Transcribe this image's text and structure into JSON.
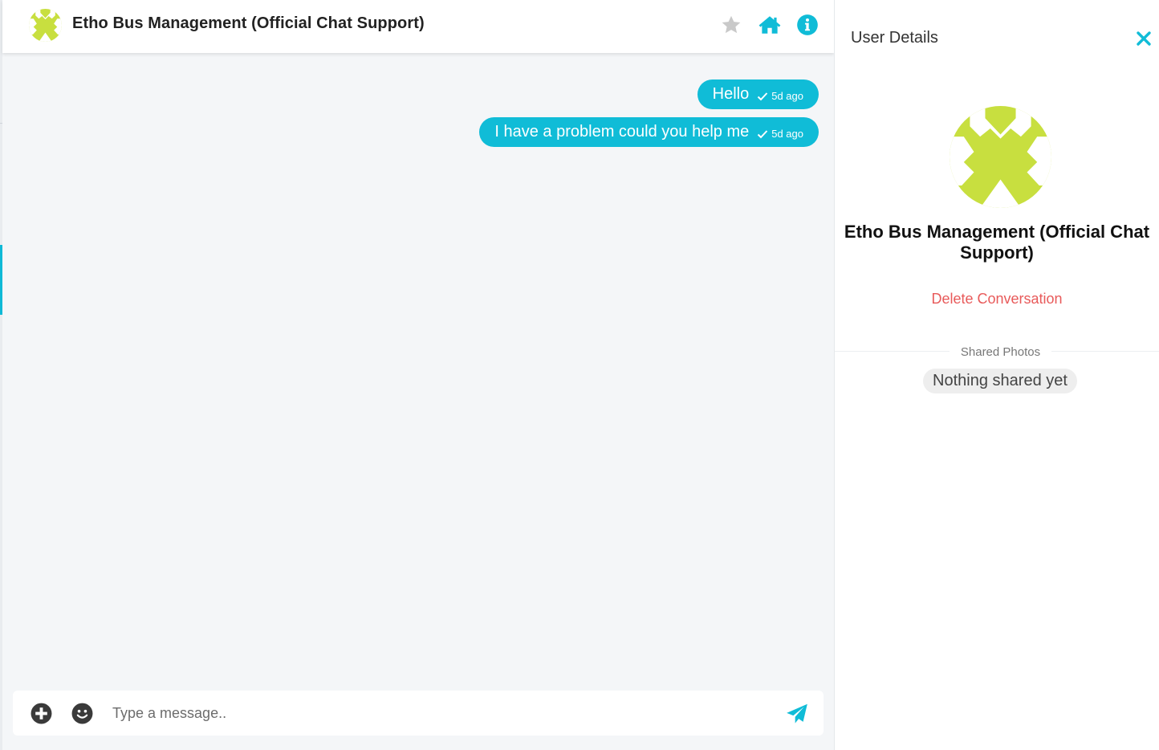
{
  "header": {
    "title": "Etho Bus Management (Official Chat Support)",
    "icons": [
      "star-icon",
      "home-icon",
      "info-icon"
    ]
  },
  "messages": [
    {
      "text": "Hello",
      "time": "5d ago",
      "status": "sent"
    },
    {
      "text": "I have a problem could you help me",
      "time": "5d ago",
      "status": "sent"
    }
  ],
  "composer": {
    "placeholder": "Type a message..",
    "icons": [
      "add-icon",
      "emoji-icon",
      "send-icon"
    ]
  },
  "details": {
    "title": "User Details",
    "name": "Etho Bus Management (Official Chat Support)",
    "delete_label": "Delete Conversation",
    "shared_label": "Shared Photos",
    "empty_label": "Nothing shared yet"
  },
  "colors": {
    "accent": "#10bcd7",
    "avatar": "#c8df3f",
    "danger": "#e85a5a",
    "chat_bg": "#f4f6f8"
  }
}
